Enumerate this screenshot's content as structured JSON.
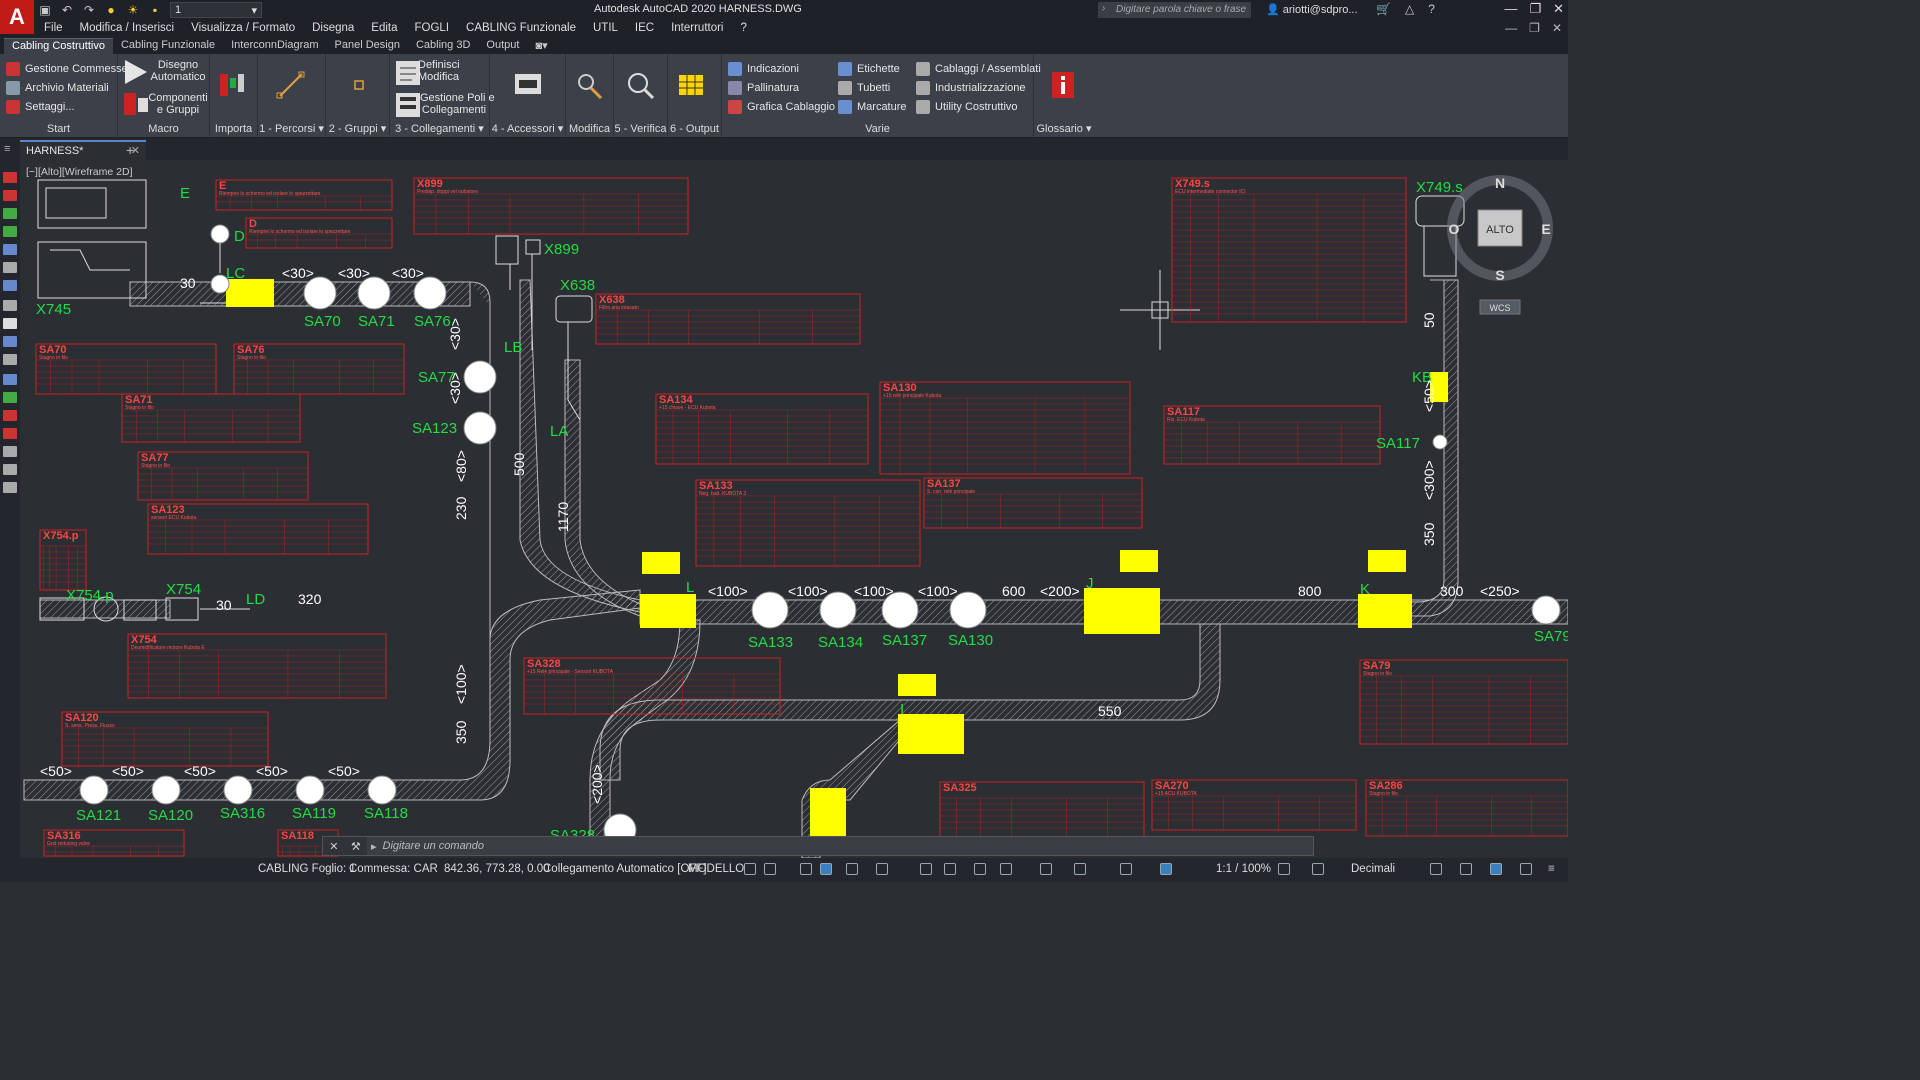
{
  "app": {
    "logo": "A",
    "title": "Autodesk AutoCAD 2020    HARNESS.DWG",
    "layer_value": "1",
    "search_placeholder": "Digitare parola chiave o frase",
    "user": "ariotti@sdpro..."
  },
  "menu": [
    "File",
    "Modifica / Inserisci",
    "Visualizza / Formato",
    "Disegna",
    "Edita",
    "FOGLI",
    "CABLING Funzionale",
    "UTIL",
    "IEC",
    "Interruttori",
    "?"
  ],
  "ribbon_tabs": [
    "Cabling Costruttivo",
    "Cabling Funzionale",
    "InterconnDiagram",
    "Panel Design",
    "Cabling 3D",
    "Output"
  ],
  "ribbon": {
    "start": {
      "items": [
        "Gestione Commesse",
        "Archivio Materiali",
        "Settaggi..."
      ],
      "label": "Start"
    },
    "macro": {
      "disegno": "Disegno\nAutomatico",
      "componenti": "Componenti\ne Gruppi",
      "label": "Macro"
    },
    "importa": "Importa",
    "percorsi": "1 - Percorsi",
    "gruppi": "2 - Gruppi",
    "collegamenti": {
      "definisci": "Definisci\nModifica",
      "gestione": "Gestione Poli e\nCollegamenti",
      "label": "3 - Collegamenti"
    },
    "accessori": "4 - Accessori",
    "modifica": "Modifica",
    "verifica": "5 - Verifica",
    "output": "6 - Output",
    "varie": {
      "col1": [
        "Indicazioni",
        "Pallinatura",
        "Grafica Cablaggio"
      ],
      "col2": [
        "Etichette",
        "Tubetti",
        "Marcature"
      ],
      "col3": [
        "Cablaggi / Assemblati",
        "Industrializzazione",
        "Utility Costruttivo"
      ],
      "label": "Varie"
    },
    "glossario": "Glossario"
  },
  "doc_tab": "HARNESS*",
  "viewport_label": "[−][Alto][Wireframe 2D]",
  "viewcube": {
    "n": "N",
    "s": "S",
    "e": "E",
    "o": "O",
    "face": "ALTO",
    "wcs": "WCS"
  },
  "drawing": {
    "connectors": [
      "X745",
      "X899",
      "X638",
      "X749.s",
      "X754.p",
      "X754",
      "LC",
      "LB",
      "LA",
      "KB",
      "L",
      "J",
      "K",
      "I",
      "LD",
      "E",
      "D"
    ],
    "splices": [
      "SA70",
      "SA71",
      "SA76",
      "SA77",
      "SA123",
      "SA117",
      "SA133",
      "SA134",
      "SA137",
      "SA130",
      "SA79",
      "SA121",
      "SA120",
      "SA316",
      "SA119",
      "SA118",
      "SA328"
    ],
    "dims": [
      "30",
      "<30>",
      "<30>",
      "<30>",
      "<100>",
      "<100>",
      "<100>",
      "<100>",
      "600",
      "<200>",
      "800",
      "300",
      "<250>",
      "320",
      "550",
      "<50>",
      "<50>",
      "<50>",
      "<50>",
      "<50>",
      "500",
      "1170",
      "230",
      "<80>",
      "350",
      "<100>",
      "350",
      "<300>",
      "50",
      "<50>",
      "<200>",
      "30",
      "<30>",
      "<30>"
    ],
    "tables": [
      {
        "id": "tbl-x899",
        "title": "X899",
        "sub": "Predisp. doppi vel radiatore"
      },
      {
        "id": "tbl-x638",
        "title": "X638",
        "sub": "Filtro aria intasato"
      },
      {
        "id": "tbl-x749",
        "title": "X749.s",
        "sub": "ECU intermediate connector ICI"
      },
      {
        "id": "tbl-sa70",
        "title": "SA70",
        "sub": "Stagno in filo"
      },
      {
        "id": "tbl-sa76",
        "title": "SA76",
        "sub": "Stagno in filo"
      },
      {
        "id": "tbl-sa71",
        "title": "SA71",
        "sub": "Stagno in filo"
      },
      {
        "id": "tbl-sa77",
        "title": "SA77",
        "sub": "Stagno in filo"
      },
      {
        "id": "tbl-sa123",
        "title": "SA123",
        "sub": "sensori ECU Kubota"
      },
      {
        "id": "tbl-sa134",
        "title": "SA134",
        "sub": "+15 chiave - ECU Kubota"
      },
      {
        "id": "tbl-sa130",
        "title": "SA130",
        "sub": "+15 relè principale Kubota"
      },
      {
        "id": "tbl-sa117",
        "title": "SA117",
        "sub": "Ris. ECU Kubota"
      },
      {
        "id": "tbl-sa133",
        "title": "SA133",
        "sub": "Neg. batt. KUBOTA 3"
      },
      {
        "id": "tbl-sa137",
        "title": "SA137",
        "sub": "S. con. relè principale"
      },
      {
        "id": "tbl-x754p",
        "title": "X754.p",
        "sub": ""
      },
      {
        "id": "tbl-x754",
        "title": "X754",
        "sub": "Deumidificatore motore Kubota E"
      },
      {
        "id": "tbl-sa328",
        "title": "SA328",
        "sub": "+15 Relè principale - Sensori KUBOTA"
      },
      {
        "id": "tbl-sa79",
        "title": "SA79",
        "sub": "Stagno in filo"
      },
      {
        "id": "tbl-sa120",
        "title": "SA120",
        "sub": "S. sens. Press. Flusso"
      },
      {
        "id": "tbl-sa325",
        "title": "SA325",
        "sub": ""
      },
      {
        "id": "tbl-sa270",
        "title": "SA270",
        "sub": "+15 ACU KUBOTA"
      },
      {
        "id": "tbl-sa286",
        "title": "SA286",
        "sub": "Stagno in filo"
      },
      {
        "id": "tbl-sa316",
        "title": "SA316",
        "sub": "Gnd reducing valve"
      },
      {
        "id": "tbl-sa118",
        "title": "SA118",
        "sub": ""
      },
      {
        "id": "tbl-e",
        "title": "E",
        "sub": "Riempire lo schermo ed isolare lo spezzettare"
      },
      {
        "id": "tbl-d",
        "title": "D",
        "sub": "Riempire lo schermo ed isolare lo spezzettare"
      }
    ]
  },
  "command_placeholder": "Digitare un comando",
  "status": {
    "foglio": "CABLING Foglio: 1",
    "commessa": "Commessa: CAR",
    "coords": "842.36, 773.28, 0.00",
    "autoconn": "Collegamento Automatico [OFF]",
    "model": "MODELLO",
    "scale": "1:1 / 100%",
    "units": "Decimali"
  },
  "colors": {
    "bg": "#2b2e33",
    "red": "#cc2222",
    "yellow": "#ffff00",
    "green": "#22dd44",
    "cyan": "#22cccc",
    "white": "#ffffff"
  }
}
